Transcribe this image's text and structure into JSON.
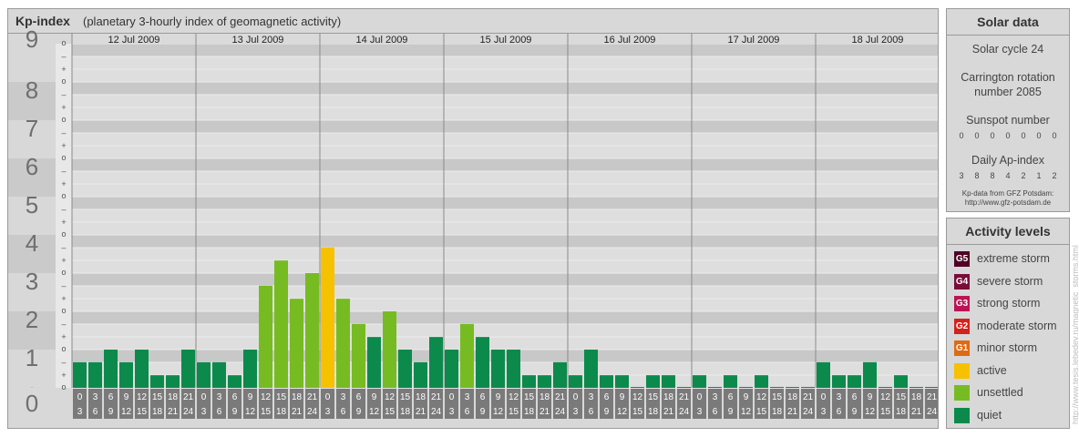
{
  "header": {
    "title": "Kp-index",
    "subtitle": "(planetary 3-hourly index of geomagnetic activity)"
  },
  "chart_data": {
    "type": "bar",
    "title": "Kp-index",
    "ylim": [
      0,
      9
    ],
    "yticks": [
      "0",
      "1",
      "2",
      "3",
      "4",
      "5",
      "6",
      "7",
      "8",
      "9"
    ],
    "subticks": [
      "o",
      "+",
      "–"
    ],
    "days": [
      "12 Jul 2009",
      "13 Jul 2009",
      "14 Jul 2009",
      "15 Jul 2009",
      "16 Jul 2009",
      "17 Jul 2009",
      "18 Jul 2009"
    ],
    "interval_start": [
      "0",
      "3",
      "6",
      "9",
      "12",
      "15",
      "18",
      "21"
    ],
    "interval_end": [
      "3",
      "6",
      "9",
      "12",
      "15",
      "18",
      "21",
      "24"
    ],
    "values": [
      0.67,
      0.67,
      1.0,
      0.67,
      1.0,
      0.33,
      0.33,
      1.0,
      0.67,
      0.67,
      0.33,
      1.0,
      2.67,
      3.33,
      2.33,
      3.0,
      3.67,
      2.33,
      1.67,
      1.33,
      2.0,
      1.0,
      0.67,
      1.33,
      1.0,
      1.67,
      1.33,
      1.0,
      1.0,
      0.33,
      0.33,
      0.67,
      0.33,
      1.0,
      0.33,
      0.33,
      0,
      0.33,
      0.33,
      0,
      0.33,
      0,
      0.33,
      0,
      0.33,
      0,
      0,
      0,
      0.67,
      0.33,
      0.33,
      0.67,
      0,
      0.33,
      0,
      0
    ],
    "categories": [
      "quiet",
      "quiet",
      "quiet",
      "quiet",
      "quiet",
      "quiet",
      "quiet",
      "quiet",
      "quiet",
      "quiet",
      "quiet",
      "quiet",
      "unsettled",
      "unsettled",
      "unsettled",
      "unsettled",
      "active",
      "unsettled",
      "unsettled",
      "quiet",
      "unsettled",
      "quiet",
      "quiet",
      "quiet",
      "quiet",
      "unsettled",
      "quiet",
      "quiet",
      "quiet",
      "quiet",
      "quiet",
      "quiet",
      "quiet",
      "quiet",
      "quiet",
      "quiet",
      "quiet",
      "quiet",
      "quiet",
      "quiet",
      "quiet",
      "quiet",
      "quiet",
      "quiet",
      "quiet",
      "quiet",
      "quiet",
      "quiet",
      "quiet",
      "quiet",
      "quiet",
      "quiet",
      "quiet",
      "quiet",
      "quiet",
      "quiet"
    ],
    "grid": true
  },
  "colors": {
    "quiet": "#0b8a4c",
    "unsettled": "#77bb22",
    "active": "#f6c100",
    "g1": "#e06a14",
    "g2": "#d4221c",
    "g3": "#bb1455",
    "g4": "#7a0c3a",
    "g5": "#500025",
    "band_dark": "#c8c8c8",
    "band_light": "#dddddd"
  },
  "solar": {
    "title": "Solar data",
    "cycle": "Solar cycle 24",
    "carrington_1": "Carrington rotation",
    "carrington_2": "number 2085",
    "sunspot_label": "Sunspot number",
    "sunspot_values": [
      "0",
      "0",
      "0",
      "0",
      "0",
      "0",
      "0"
    ],
    "ap_label": "Daily Ap-index",
    "ap_values": [
      "3",
      "8",
      "8",
      "4",
      "2",
      "1",
      "2"
    ],
    "credit_1": "Kp-data from GFZ Potsdam:",
    "credit_2": "http://www.gfz-potsdam.de"
  },
  "activity": {
    "title": "Activity levels",
    "levels": [
      {
        "badge": "G5",
        "label": "extreme storm",
        "color": "#500025"
      },
      {
        "badge": "G4",
        "label": "severe storm",
        "color": "#7a0c3a"
      },
      {
        "badge": "G3",
        "label": "strong storm",
        "color": "#bb1455"
      },
      {
        "badge": "G2",
        "label": "moderate storm",
        "color": "#d4221c"
      },
      {
        "badge": "G1",
        "label": "minor storm",
        "color": "#e06a14"
      },
      {
        "badge": "",
        "label": "active",
        "color": "#f6c100"
      },
      {
        "badge": "",
        "label": "unsettled",
        "color": "#77bb22"
      },
      {
        "badge": "",
        "label": "quiet",
        "color": "#0b8a4c"
      }
    ]
  },
  "watermark": "http://www.tesis.lebedev.ru/magnetic_storms.html"
}
